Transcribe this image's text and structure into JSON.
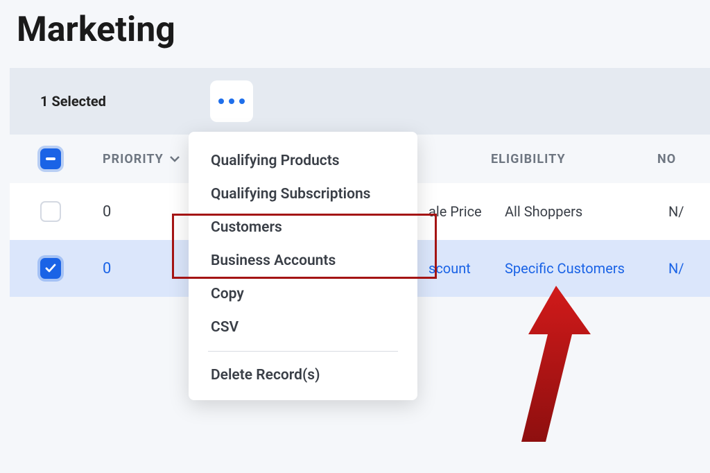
{
  "page": {
    "title": "Marketing"
  },
  "toolbar": {
    "selected_label": "1 Selected"
  },
  "table": {
    "columns": {
      "priority": "Priority",
      "eligibility": "Eligibility",
      "no": "NO"
    },
    "rows": [
      {
        "checked": false,
        "priority": "0",
        "type_partial": "ale Price",
        "eligibility": "All Shoppers",
        "no_partial": "N/"
      },
      {
        "checked": true,
        "priority": "0",
        "type_partial": "scount",
        "eligibility": "Specific Customers",
        "no_partial": "N/"
      }
    ]
  },
  "dropdown": {
    "items_group1": [
      "Qualifying Products",
      "Qualifying Subscriptions",
      "Customers",
      "Business Accounts",
      "Copy",
      "CSV"
    ],
    "items_group2": [
      "Delete Record(s)"
    ]
  }
}
